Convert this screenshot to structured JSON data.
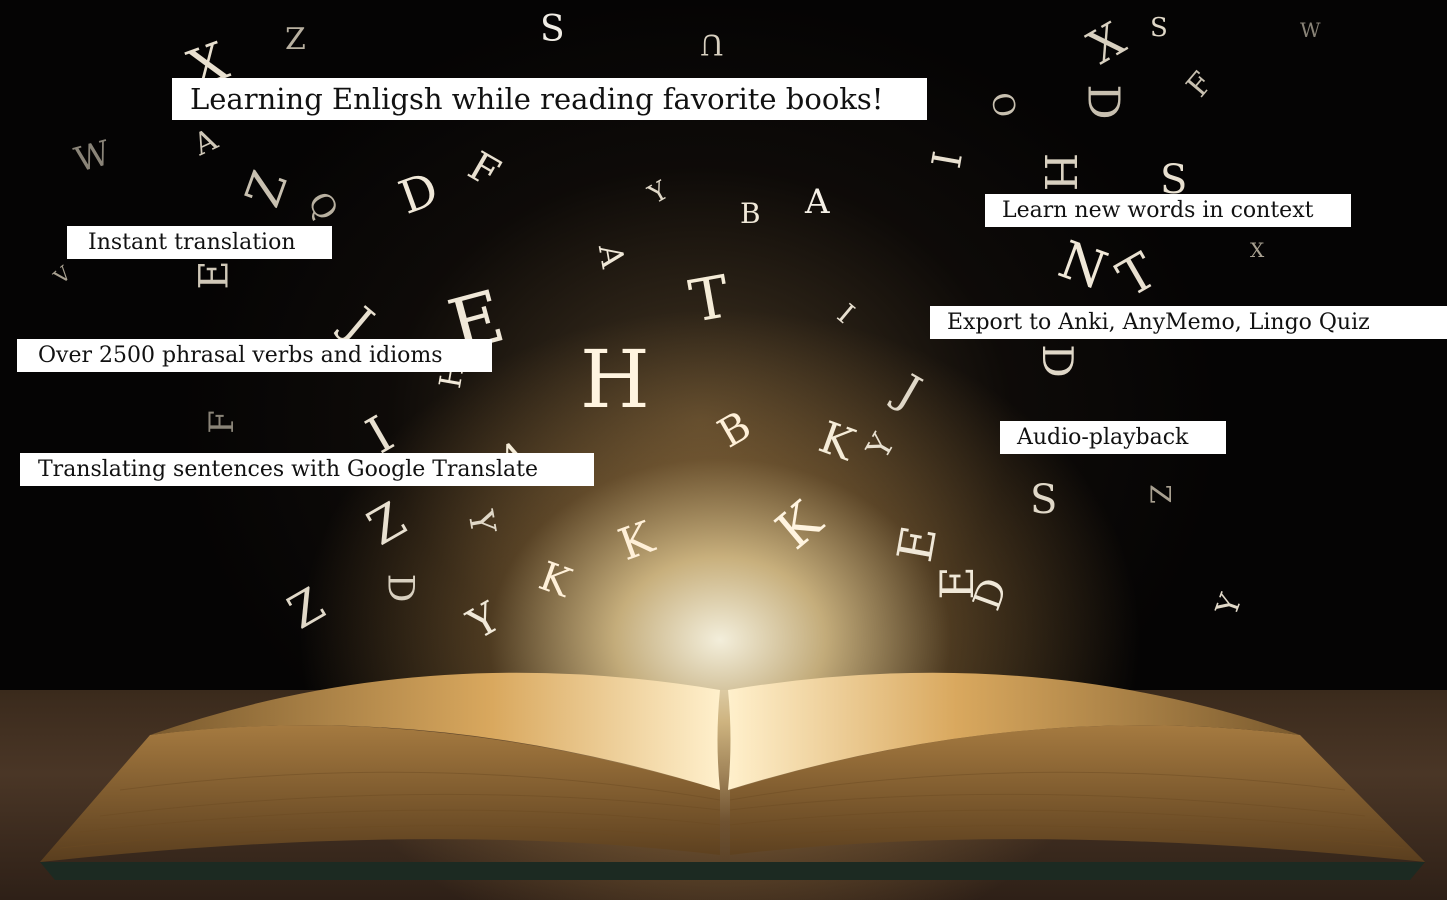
{
  "title": "Learning Enligsh while reading favorite books!",
  "features": [
    "Instant translation",
    "Over 2500 phrasal verbs and idioms",
    "Translating sentences with Google Translate",
    "Learn new words in context",
    "Export to Anki, AnyMemo, Lingo Quiz",
    "Audio-playback"
  ],
  "illustration": {
    "subject": "open-book-with-flying-letters",
    "colors": {
      "background": "#050404",
      "glow": "#fff3d6",
      "pages": "#c99a55",
      "cover": "#1c2a22",
      "table": "#3a2a1c",
      "label_bg": "#ffffff",
      "label_text": "#111111"
    }
  }
}
